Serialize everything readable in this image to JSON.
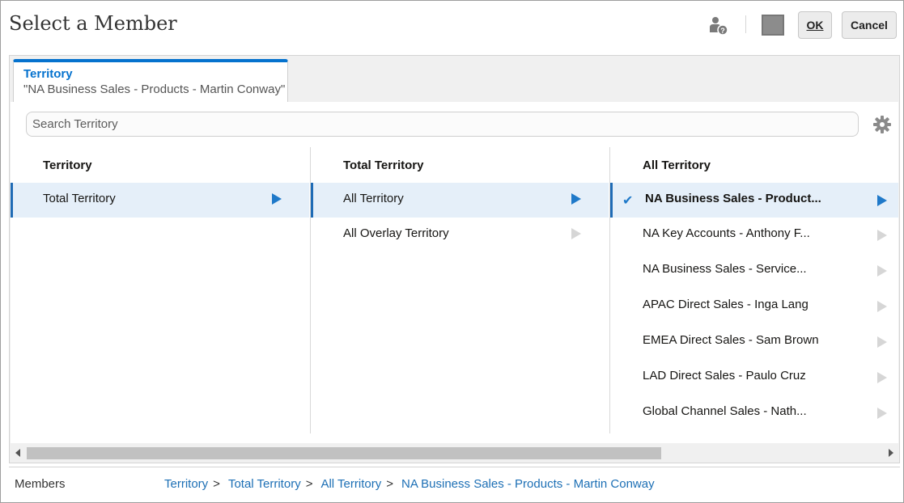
{
  "dialog": {
    "title": "Select a Member",
    "ok_label": "OK",
    "cancel_label": "Cancel"
  },
  "tab": {
    "title": "Territory",
    "subtitle": "\"NA Business Sales - Products - Martin Conway\""
  },
  "search": {
    "placeholder": "Search Territory"
  },
  "columns": [
    {
      "header": "Territory",
      "items": [
        {
          "label": "Total Territory",
          "selected": true
        }
      ]
    },
    {
      "header": "Total Territory",
      "items": [
        {
          "label": "All Territory",
          "selected": true
        },
        {
          "label": "All Overlay Territory",
          "selected": false
        }
      ]
    },
    {
      "header": "All Territory",
      "items": [
        {
          "label": "NA Business Sales - Product...",
          "selected": true
        },
        {
          "label": "NA Key Accounts - Anthony F...",
          "selected": false
        },
        {
          "label": "NA Business Sales - Service...",
          "selected": false
        },
        {
          "label": "APAC Direct Sales - Inga Lang",
          "selected": false
        },
        {
          "label": "EMEA Direct Sales - Sam Brown",
          "selected": false
        },
        {
          "label": "LAD Direct Sales - Paulo Cruz",
          "selected": false
        },
        {
          "label": "Global Channel Sales - Nath...",
          "selected": false
        }
      ]
    }
  ],
  "footer": {
    "label": "Members",
    "breadcrumbs": [
      "Territory",
      "Total Territory",
      "All Territory",
      "NA Business Sales - Products - Martin Conway"
    ],
    "separator": ">"
  },
  "icons": {
    "help": "user-help-icon",
    "settings": "gear-icon",
    "check": "checkmark-icon",
    "arrow": "chevron-right-icon"
  },
  "colors": {
    "accent": "#0572ce",
    "link": "#1c6fb5",
    "selection_bg": "#e5eff9"
  }
}
